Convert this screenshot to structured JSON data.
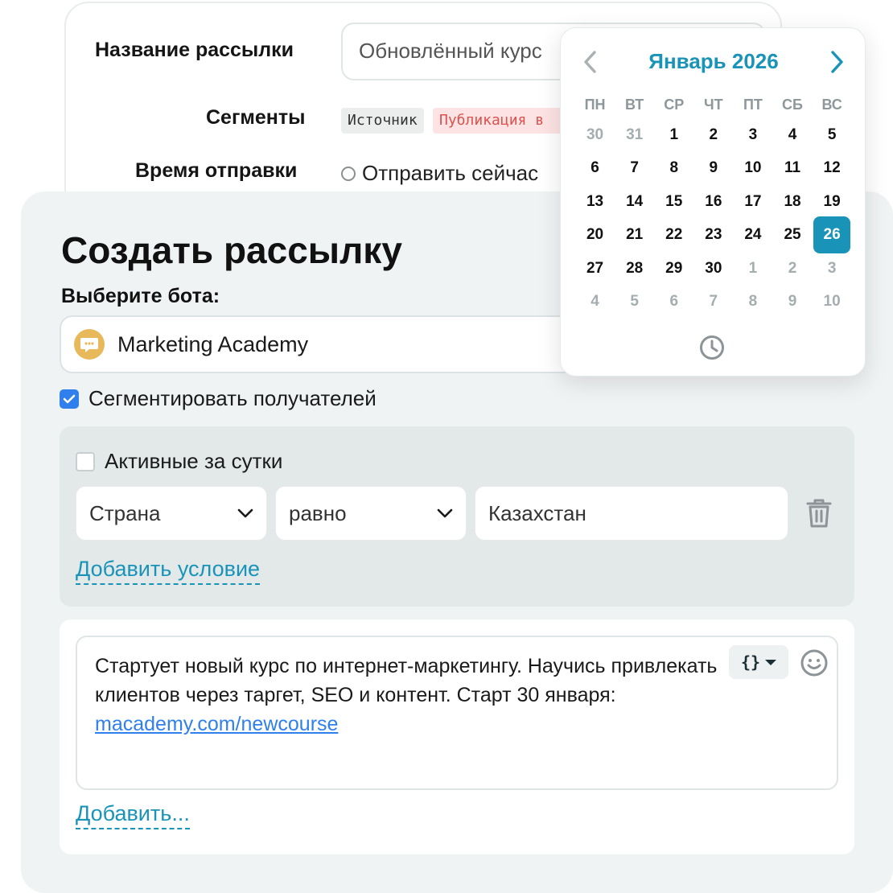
{
  "settings": {
    "name_label": "Название рассылки",
    "name_value": "Обновлённый курс",
    "segments_label": "Сегменты",
    "segment_tags": [
      "Источник",
      "Публикация в"
    ],
    "send_time_label": "Время отправки",
    "send_now_label": "Отправить сейчас"
  },
  "form": {
    "title": "Создать рассылку",
    "bot_label": "Выберите бота:",
    "bot_name": "Marketing Academy",
    "segment_checkbox_label": "Сегментировать получателей",
    "segment_checked": true
  },
  "filters": {
    "active_day_label": "Активные за сутки",
    "active_day_checked": false,
    "condition": {
      "field": "Страна",
      "operator": "равно",
      "value": "Казахстан"
    },
    "add_condition_label": "Добавить условие"
  },
  "message": {
    "text_part1": "Стартует новый курс по интернет-маркетингу. Научись привлекать клиентов через таргет, SEO и контент. Старт 30 января: ",
    "link_text": "macademy.com/newcourse",
    "variables_label": "{}",
    "add_label": "Добавить..."
  },
  "calendar": {
    "title": "Январь 2026",
    "weekdays": [
      "ПН",
      "ВТ",
      "СР",
      "ЧТ",
      "ПТ",
      "СБ",
      "ВС"
    ],
    "weeks": [
      [
        {
          "d": "30",
          "m": true
        },
        {
          "d": "31",
          "m": true
        },
        {
          "d": "1"
        },
        {
          "d": "2"
        },
        {
          "d": "3"
        },
        {
          "d": "4"
        },
        {
          "d": "5"
        }
      ],
      [
        {
          "d": "6"
        },
        {
          "d": "7"
        },
        {
          "d": "8"
        },
        {
          "d": "9"
        },
        {
          "d": "10"
        },
        {
          "d": "11"
        },
        {
          "d": "12"
        }
      ],
      [
        {
          "d": "13"
        },
        {
          "d": "14"
        },
        {
          "d": "15"
        },
        {
          "d": "16"
        },
        {
          "d": "17"
        },
        {
          "d": "18"
        },
        {
          "d": "19"
        }
      ],
      [
        {
          "d": "20"
        },
        {
          "d": "21"
        },
        {
          "d": "22"
        },
        {
          "d": "23"
        },
        {
          "d": "24"
        },
        {
          "d": "25"
        },
        {
          "d": "26",
          "s": true
        }
      ],
      [
        {
          "d": "27"
        },
        {
          "d": "28"
        },
        {
          "d": "29"
        },
        {
          "d": "30"
        },
        {
          "d": "1",
          "m": true
        },
        {
          "d": "2",
          "m": true
        },
        {
          "d": "3",
          "m": true
        }
      ],
      [
        {
          "d": "4",
          "m": true
        },
        {
          "d": "5",
          "m": true
        },
        {
          "d": "6",
          "m": true
        },
        {
          "d": "7",
          "m": true
        },
        {
          "d": "8",
          "m": true
        },
        {
          "d": "9",
          "m": true
        },
        {
          "d": "10",
          "m": true
        }
      ]
    ],
    "selected_day": "26"
  },
  "icons": {
    "bot_avatar": "chat-bubble-icon",
    "dropdown": "chevron-down-icon",
    "delete": "trash-icon",
    "emoji": "smiley-icon",
    "prev": "chevron-left-icon",
    "next": "chevron-right-icon",
    "time": "clock-icon"
  },
  "colors": {
    "accent": "#1994b8",
    "checkbox": "#2f80ed",
    "link": "#2f80ed",
    "bot_avatar": "#e7b95a",
    "tag_red": "#d9534f"
  }
}
